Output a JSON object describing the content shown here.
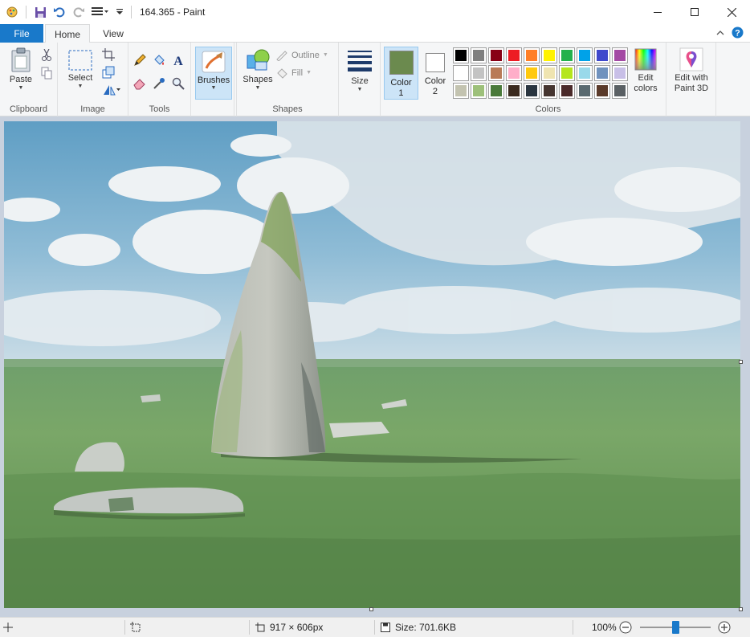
{
  "window": {
    "title": "164.365 - Paint"
  },
  "tabs": {
    "file": "File",
    "home": "Home",
    "view": "View"
  },
  "ribbon": {
    "clipboard": {
      "paste": "Paste",
      "group": "Clipboard"
    },
    "image": {
      "select": "Select",
      "group": "Image"
    },
    "tools": {
      "group": "Tools"
    },
    "brushes": {
      "label": "Brushes"
    },
    "shapes": {
      "shapes": "Shapes",
      "outline": "Outline",
      "fill": "Fill",
      "group": "Shapes"
    },
    "size": {
      "label": "Size"
    },
    "colors": {
      "color1_line1": "Color",
      "color1_line2": "1",
      "color2_line1": "Color",
      "color2_line2": "2",
      "edit_line1": "Edit",
      "edit_line2": "colors",
      "paint3d_line1": "Edit with",
      "paint3d_line2": "Paint 3D",
      "group": "Colors",
      "color1_value": "#6b8a4e",
      "color2_value": "#ffffff",
      "palette": [
        "#000000",
        "#7f7f7f",
        "#880015",
        "#ed1c24",
        "#ff7f27",
        "#fff200",
        "#22b14c",
        "#00a2e8",
        "#3f48cc",
        "#a349a4",
        "#ffffff",
        "#c3c3c3",
        "#b97a57",
        "#ffaec9",
        "#ffc90e",
        "#efe4b0",
        "#b5e61d",
        "#99d9ea",
        "#7092be",
        "#c8bfe7",
        "#c3c3b0",
        "#9dc07a",
        "#4a7a3a",
        "#3a2a1e",
        "#2a3540",
        "#453530",
        "#4a2a2a",
        "#5a6a70",
        "#5a3a2a",
        "#5a6064"
      ]
    }
  },
  "status": {
    "dimensions": "917 × 606px",
    "size": "Size: 701.6KB",
    "zoom": "100%"
  }
}
